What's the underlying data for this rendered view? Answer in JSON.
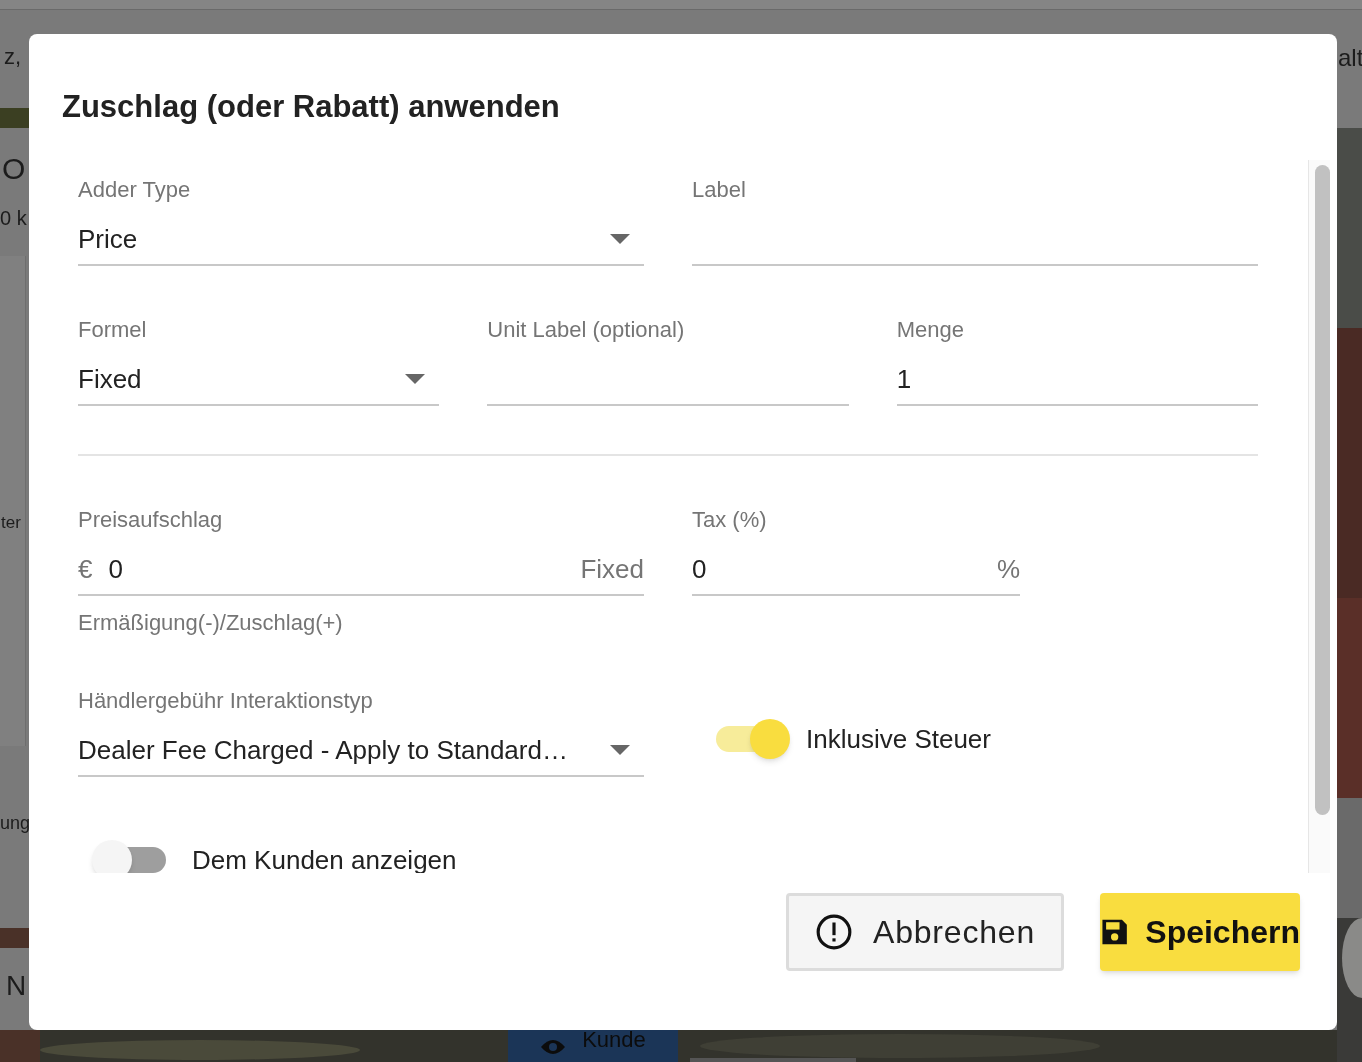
{
  "background": {
    "texts": [
      "z,",
      "O",
      "0 k",
      "ter",
      "ung",
      "N",
      "alt"
    ],
    "button": "Kunde"
  },
  "dialog": {
    "title": "Zuschlag (oder Rabatt) anwenden",
    "rows": [
      {
        "fields": [
          {
            "kind": "select",
            "label": "Adder Type",
            "value": "Price"
          },
          {
            "kind": "text",
            "label": "Label"
          }
        ]
      },
      {
        "fields": [
          {
            "kind": "select",
            "label": "Formel",
            "value": "Fixed"
          },
          {
            "kind": "text",
            "label": "Unit Label (optional)"
          },
          {
            "kind": "text",
            "label": "Menge",
            "value": "1"
          }
        ]
      },
      {
        "fields": [
          {
            "kind": "text",
            "label": "Preisaufschlag",
            "prefix": "€",
            "value": "0",
            "suffix": "Fixed",
            "helper": "Ermäßigung(-)/Zuschlag(+)"
          },
          {
            "kind": "text",
            "label": "Tax (%)",
            "value": "0",
            "suffix": "%"
          }
        ]
      }
    ],
    "dealer_fee": {
      "label": "Händlergebühr Interaktionstyp",
      "value": "Dealer Fee Charged - Apply to Standard…"
    },
    "tax_inclusive": {
      "label": "Inklusive Steuer",
      "on": true
    },
    "show_customer": {
      "label": "Dem Kunden anzeigen",
      "on": false
    },
    "buttons": [
      {
        "kind": "cancel",
        "label": "Abbrechen"
      },
      {
        "kind": "save",
        "label": "Speichern"
      }
    ]
  }
}
